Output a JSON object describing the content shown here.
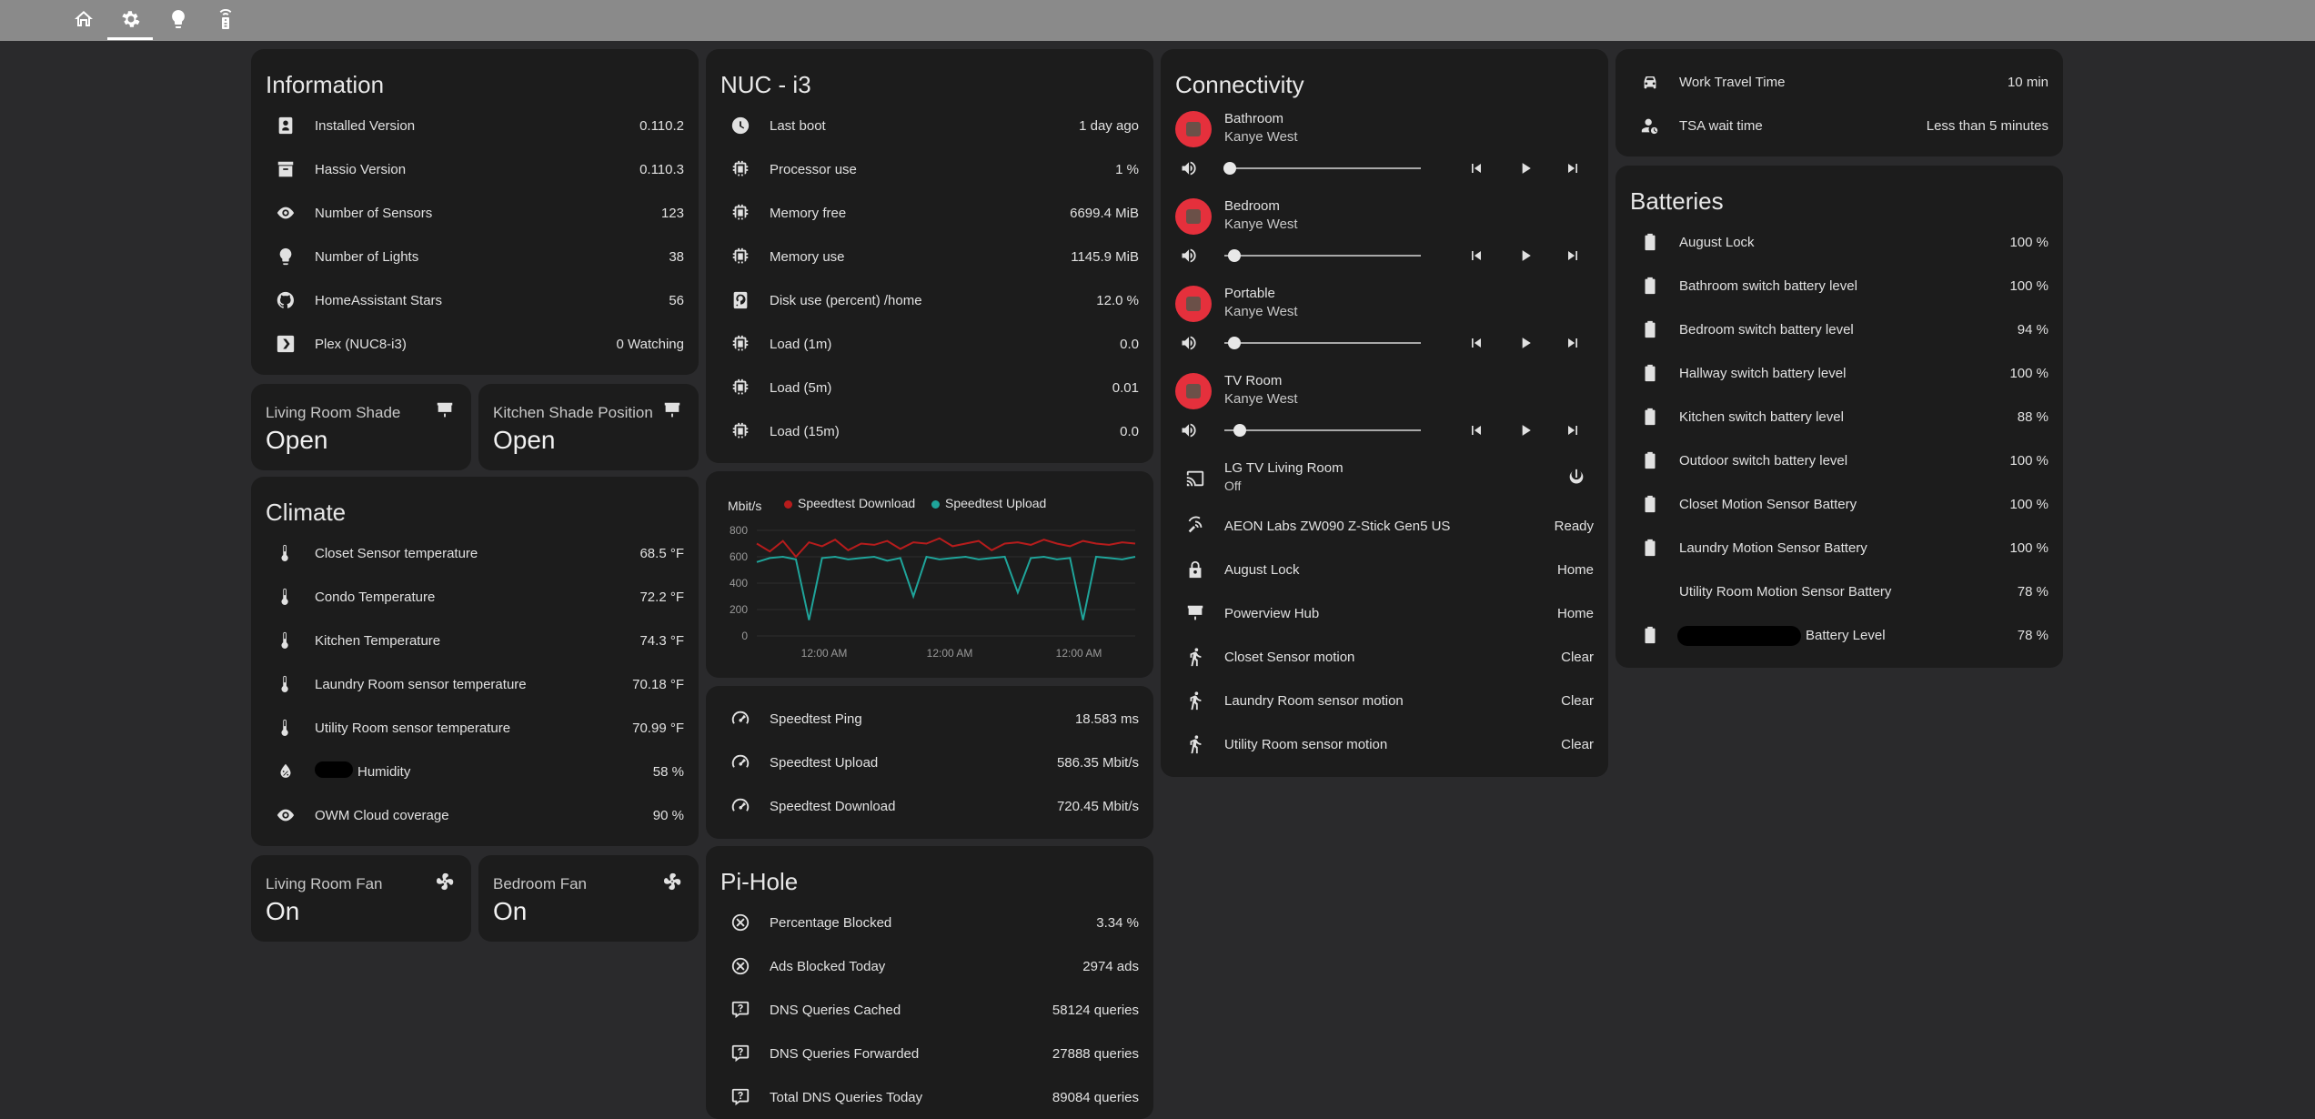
{
  "nav": {
    "tabs": [
      {
        "icon": "home-icon"
      },
      {
        "icon": "gear-icon",
        "active": true
      },
      {
        "icon": "lightbulb-icon"
      },
      {
        "icon": "remote-icon"
      }
    ]
  },
  "information": {
    "title": "Information",
    "rows": [
      {
        "icon": "badge-icon",
        "label": "Installed Version",
        "value": "0.110.2"
      },
      {
        "icon": "archive-icon",
        "label": "Hassio Version",
        "value": "0.110.3"
      },
      {
        "icon": "eye-icon",
        "label": "Number of Sensors",
        "value": "123"
      },
      {
        "icon": "lightbulb-icon",
        "label": "Number of Lights",
        "value": "38"
      },
      {
        "icon": "github-icon",
        "label": "HomeAssistant Stars",
        "value": "56"
      },
      {
        "icon": "plex-icon",
        "label": "Plex (NUC8-i3)",
        "value": "0 Watching"
      }
    ]
  },
  "shades": [
    {
      "name": "Living Room Shade",
      "state": "Open",
      "icon": "shade-icon"
    },
    {
      "name": "Kitchen Shade Position",
      "state": "Open",
      "icon": "shade-icon"
    }
  ],
  "climate": {
    "title": "Climate",
    "rows": [
      {
        "icon": "thermometer-icon",
        "label": "Closet Sensor temperature",
        "value": "68.5 °F"
      },
      {
        "icon": "thermometer-icon",
        "label": "Condo Temperature",
        "value": "72.2 °F"
      },
      {
        "icon": "thermometer-icon",
        "label": "Kitchen Temperature",
        "value": "74.3 °F"
      },
      {
        "icon": "thermometer-icon",
        "label": "Laundry Room sensor temperature",
        "value": "70.18 °F"
      },
      {
        "icon": "thermometer-icon",
        "label": "Utility Room sensor temperature",
        "value": "70.99 °F"
      },
      {
        "icon": "water-percent-icon",
        "label": "Humidity",
        "value": "58 %"
      },
      {
        "icon": "eye-icon",
        "label": "OWM Cloud coverage",
        "value": "90 %"
      }
    ]
  },
  "fans": [
    {
      "name": "Living Room Fan",
      "state": "On",
      "icon": "fan-icon"
    },
    {
      "name": "Bedroom Fan",
      "state": "On",
      "icon": "fan-icon"
    }
  ],
  "nuc": {
    "title": "NUC - i3",
    "rows": [
      {
        "icon": "clock-icon",
        "label": "Last boot",
        "value": "1 day ago"
      },
      {
        "icon": "chip-icon",
        "label": "Processor use",
        "value": "1 %"
      },
      {
        "icon": "chip-icon",
        "label": "Memory free",
        "value": "6699.4 MiB"
      },
      {
        "icon": "chip-icon",
        "label": "Memory use",
        "value": "1145.9 MiB"
      },
      {
        "icon": "harddisk-icon",
        "label": "Disk use (percent) /home",
        "value": "12.0 %"
      },
      {
        "icon": "chip-icon",
        "label": "Load (1m)",
        "value": "0.0"
      },
      {
        "icon": "chip-icon",
        "label": "Load (5m)",
        "value": "0.01"
      },
      {
        "icon": "chip-icon",
        "label": "Load (15m)",
        "value": "0.0"
      }
    ]
  },
  "speedtest_chart": {
    "unit_label": "Mbit/s",
    "legend": [
      {
        "name": "Speedtest Download",
        "color": "#b71c1c"
      },
      {
        "name": "Speedtest Upload",
        "color": "#1fa49a"
      }
    ],
    "y_ticks": [
      "800",
      "600",
      "400",
      "200",
      "0"
    ],
    "x_ticks": [
      "12:00 AM",
      "12:00 AM",
      "12:00 AM"
    ]
  },
  "chart_data": {
    "type": "line",
    "ylim": [
      0,
      800
    ],
    "ylabel": "Mbit/s",
    "x": [
      "12:00 AM",
      "12:00 AM",
      "12:00 AM"
    ],
    "series": [
      {
        "name": "Speedtest Download",
        "color": "#b71c1c",
        "values": [
          700,
          640,
          720,
          600,
          710,
          680,
          730,
          650,
          700,
          690,
          720,
          660,
          710,
          700,
          740,
          680,
          700,
          720,
          650,
          700,
          710,
          690,
          730,
          700,
          680,
          720,
          700,
          690,
          710,
          700
        ]
      },
      {
        "name": "Speedtest Upload",
        "color": "#1fa49a",
        "values": [
          560,
          590,
          600,
          580,
          120,
          590,
          600,
          580,
          590,
          600,
          570,
          590,
          300,
          600,
          580,
          590,
          600,
          580,
          590,
          600,
          330,
          590,
          600,
          580,
          590,
          120,
          600,
          590,
          580,
          600
        ]
      }
    ]
  },
  "speedtest": {
    "rows": [
      {
        "icon": "speedometer-icon",
        "label": "Speedtest Ping",
        "value": "18.583 ms"
      },
      {
        "icon": "speedometer-icon",
        "label": "Speedtest Upload",
        "value": "586.35 Mbit/s"
      },
      {
        "icon": "speedometer-icon",
        "label": "Speedtest Download",
        "value": "720.45 Mbit/s"
      }
    ]
  },
  "pihole": {
    "title": "Pi-Hole",
    "rows": [
      {
        "icon": "close-circle-icon",
        "label": "Percentage Blocked",
        "value": "3.34 %"
      },
      {
        "icon": "close-circle-icon",
        "label": "Ads Blocked Today",
        "value": "2974 ads"
      },
      {
        "icon": "comment-question-icon",
        "label": "DNS Queries Cached",
        "value": "58124 queries"
      },
      {
        "icon": "comment-question-icon",
        "label": "DNS Queries Forwarded",
        "value": "27888 queries"
      },
      {
        "icon": "comment-question-icon",
        "label": "Total DNS Queries Today",
        "value": "89084 queries"
      }
    ]
  },
  "connectivity": {
    "title": "Connectivity",
    "players": [
      {
        "name": "Bathroom",
        "artist": "Kanye West",
        "volume": 0.03
      },
      {
        "name": "Bedroom",
        "artist": "Kanye West",
        "volume": 0.05
      },
      {
        "name": "Portable",
        "artist": "Kanye West",
        "volume": 0.05
      },
      {
        "name": "TV Room",
        "artist": "Kanye West",
        "volume": 0.08
      }
    ],
    "tv": {
      "name": "LG TV Living Room",
      "state": "Off"
    },
    "rows": [
      {
        "icon": "zwave-icon",
        "label": "AEON Labs ZW090 Z-Stick Gen5 US",
        "value": "Ready"
      },
      {
        "icon": "lock-icon",
        "label": "August Lock",
        "value": "Home"
      },
      {
        "icon": "shade-icon",
        "label": "Powerview Hub",
        "value": "Home"
      },
      {
        "icon": "walk-icon",
        "label": "Closet Sensor motion",
        "value": "Clear"
      },
      {
        "icon": "walk-icon",
        "label": "Laundry Room sensor motion",
        "value": "Clear"
      },
      {
        "icon": "walk-icon",
        "label": "Utility Room sensor motion",
        "value": "Clear"
      }
    ]
  },
  "travel": {
    "rows": [
      {
        "icon": "car-icon",
        "label": "Work Travel Time",
        "value": "10 min"
      },
      {
        "icon": "account-clock-icon",
        "label": "TSA wait time",
        "value": "Less than 5 minutes"
      }
    ]
  },
  "batteries": {
    "title": "Batteries",
    "rows": [
      {
        "icon": "battery-icon",
        "label": "August Lock",
        "value": "100 %"
      },
      {
        "icon": "battery-icon",
        "label": "Bathroom switch battery level",
        "value": "100 %"
      },
      {
        "icon": "battery-icon",
        "label": "Bedroom switch battery level",
        "value": "94 %"
      },
      {
        "icon": "battery-icon",
        "label": "Hallway switch battery level",
        "value": "100 %"
      },
      {
        "icon": "battery-icon",
        "label": "Kitchen switch battery level",
        "value": "88 %"
      },
      {
        "icon": "battery-icon",
        "label": "Outdoor switch battery level",
        "value": "100 %"
      },
      {
        "icon": "battery-icon",
        "label": "Closet Motion Sensor Battery",
        "value": "100 %"
      },
      {
        "icon": "battery-icon",
        "label": "Laundry Motion Sensor Battery",
        "value": "100 %"
      },
      {
        "icon": "",
        "label": "Utility Room Motion Sensor Battery",
        "value": "78 %"
      },
      {
        "icon": "battery-icon",
        "label": "Battery Level",
        "value": "78 %"
      }
    ]
  }
}
